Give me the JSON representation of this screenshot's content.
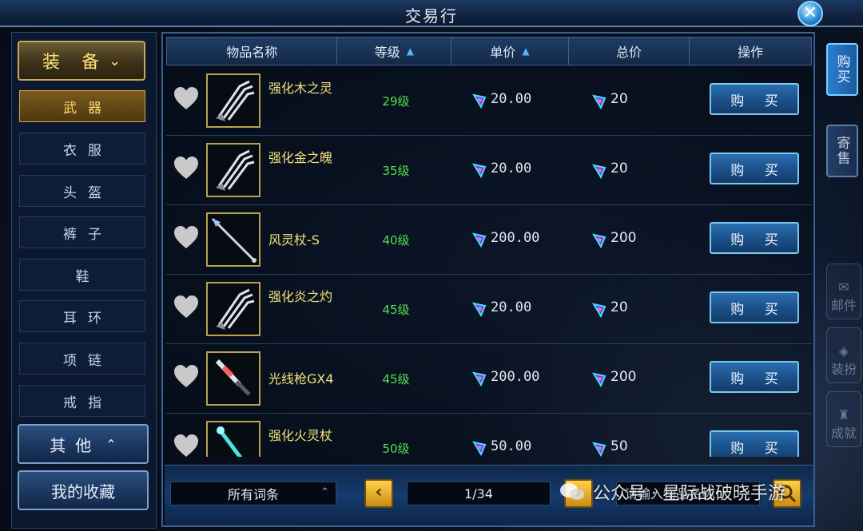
{
  "window": {
    "title": "交易行"
  },
  "sidebar": {
    "category": {
      "label": "装 备",
      "chevron": "chevron-down-icon"
    },
    "items": [
      {
        "label": "武器",
        "active": true
      },
      {
        "label": "衣服",
        "active": false
      },
      {
        "label": "头盔",
        "active": false
      },
      {
        "label": "裤子",
        "active": false
      },
      {
        "label": "鞋",
        "active": false
      },
      {
        "label": "耳环",
        "active": false
      },
      {
        "label": "项链",
        "active": false
      },
      {
        "label": "戒指",
        "active": false
      }
    ],
    "other": {
      "label": "其他",
      "chevron": "chevron-up-icon"
    },
    "favorites": {
      "label": "我的收藏"
    }
  },
  "table": {
    "headers": [
      {
        "label": "物品名称",
        "sorted": false
      },
      {
        "label": "等级",
        "sorted": true
      },
      {
        "label": "单价",
        "sorted": true
      },
      {
        "label": "总价",
        "sorted": false
      },
      {
        "label": "操作",
        "sorted": false
      }
    ],
    "buy_label": "购 买",
    "rows": [
      {
        "name": "强化木之灵",
        "level": "29级",
        "unit_price": "20.00",
        "total_price": "20",
        "icon": "claw-weapon-icon"
      },
      {
        "name": "强化金之魄",
        "level": "35级",
        "unit_price": "20.00",
        "total_price": "20",
        "icon": "claw-weapon-icon"
      },
      {
        "name": "风灵杖-S",
        "level": "40级",
        "unit_price": "200.00",
        "total_price": "200",
        "icon": "staff-weapon-icon"
      },
      {
        "name": "强化炎之灼",
        "level": "45级",
        "unit_price": "20.00",
        "total_price": "20",
        "icon": "claw-weapon-icon"
      },
      {
        "name": "光线枪GX4",
        "level": "45级",
        "unit_price": "200.00",
        "total_price": "200",
        "icon": "laser-gun-icon"
      },
      {
        "name": "强化火灵杖",
        "level": "50级",
        "unit_price": "50.00",
        "total_price": "50",
        "icon": "fire-staff-icon"
      }
    ]
  },
  "bottom": {
    "filter_label": "所有词条",
    "page": "1/34",
    "search_placeholder": "请输入物品名称"
  },
  "right_tabs": {
    "buy": "购买",
    "sell": "寄售",
    "faded": [
      "邮件",
      "装扮",
      "成就"
    ]
  },
  "watermark": {
    "text": "公众号 · 星际战破晓手游"
  },
  "colors": {
    "accent": "#4fb6ff",
    "level_green": "#4fe34f",
    "item_name_yellow": "#f3e27a",
    "active_gold": "#ffd86b"
  }
}
